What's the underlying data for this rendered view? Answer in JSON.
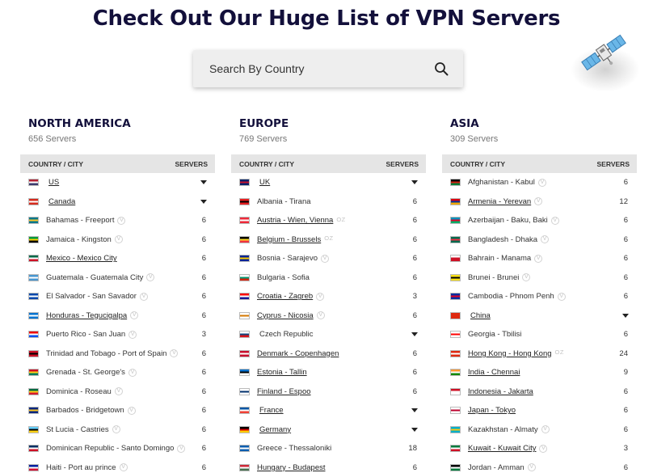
{
  "page": {
    "title": "Check Out Our Huge List of VPN Servers"
  },
  "search": {
    "placeholder": "Search By Country"
  },
  "regions": [
    {
      "title": "NORTH AMERICA",
      "count": "656 Servers",
      "col_country": "COUNTRY / CITY",
      "col_servers": "SERVERS",
      "rows": [
        {
          "name": "US",
          "servers": "",
          "expand": true,
          "link": true,
          "badge": "",
          "flag": [
            "#b22234",
            "#ffffff",
            "#3c3b6e"
          ]
        },
        {
          "name": "Canada",
          "servers": "",
          "expand": true,
          "link": true,
          "badge": "",
          "flag": [
            "#d52b1e",
            "#ffffff",
            "#d52b1e"
          ]
        },
        {
          "name": "Bahamas - Freeport",
          "servers": "6",
          "expand": false,
          "link": false,
          "badge": "V",
          "flag": [
            "#00778b",
            "#ffc72c",
            "#00778b"
          ]
        },
        {
          "name": "Jamaica - Kingston",
          "servers": "6",
          "expand": false,
          "link": false,
          "badge": "V",
          "flag": [
            "#009b3a",
            "#fed100",
            "#000000"
          ]
        },
        {
          "name": "Mexico - Mexico City",
          "servers": "6",
          "expand": false,
          "link": true,
          "badge": "",
          "flag": [
            "#006847",
            "#ffffff",
            "#ce1126"
          ]
        },
        {
          "name": "Guatemala - Guatemala City",
          "servers": "6",
          "expand": false,
          "link": false,
          "badge": "V",
          "flag": [
            "#4997d0",
            "#ffffff",
            "#4997d0"
          ]
        },
        {
          "name": "El Salvador - San Savador",
          "servers": "6",
          "expand": false,
          "link": false,
          "badge": "V",
          "flag": [
            "#0047ab",
            "#ffffff",
            "#0047ab"
          ]
        },
        {
          "name": "Honduras - Tegucigalpa",
          "servers": "6",
          "expand": false,
          "link": true,
          "badge": "V",
          "flag": [
            "#0073cf",
            "#ffffff",
            "#0073cf"
          ]
        },
        {
          "name": "Puerto Rico - San Juan",
          "servers": "3",
          "expand": false,
          "link": false,
          "badge": "V",
          "flag": [
            "#ed0000",
            "#ffffff",
            "#0050f0"
          ]
        },
        {
          "name": "Trinidad and Tobago - Port of Spain",
          "servers": "6",
          "expand": false,
          "link": false,
          "badge": "V",
          "flag": [
            "#ce1126",
            "#000000",
            "#ce1126"
          ]
        },
        {
          "name": "Grenada - St. George's",
          "servers": "6",
          "expand": false,
          "link": false,
          "badge": "V",
          "flag": [
            "#ce1126",
            "#fcd116",
            "#007a5e"
          ]
        },
        {
          "name": "Dominica - Roseau",
          "servers": "6",
          "expand": false,
          "link": false,
          "badge": "V",
          "flag": [
            "#006b3f",
            "#fcd116",
            "#d41c30"
          ]
        },
        {
          "name": "Barbados - Bridgetown",
          "servers": "6",
          "expand": false,
          "link": false,
          "badge": "V",
          "flag": [
            "#00267f",
            "#ffc726",
            "#00267f"
          ]
        },
        {
          "name": "St Lucia - Castries",
          "servers": "6",
          "expand": false,
          "link": false,
          "badge": "V",
          "flag": [
            "#65cfff",
            "#000000",
            "#fcd116"
          ]
        },
        {
          "name": "Dominican Republic - Santo Domingo",
          "servers": "6",
          "expand": false,
          "link": false,
          "badge": "V",
          "flag": [
            "#002d62",
            "#ffffff",
            "#ce1126"
          ]
        },
        {
          "name": "Haiti - Port au prince",
          "servers": "6",
          "expand": false,
          "link": false,
          "badge": "V",
          "flag": [
            "#00209f",
            "#ffffff",
            "#d21034"
          ]
        }
      ]
    },
    {
      "title": "EUROPE",
      "count": "769 Servers",
      "col_country": "COUNTRY / CITY",
      "col_servers": "SERVERS",
      "rows": [
        {
          "name": "UK",
          "servers": "",
          "expand": true,
          "link": true,
          "badge": "",
          "flag": [
            "#012169",
            "#c8102e",
            "#012169"
          ]
        },
        {
          "name": "Albania - Tirana",
          "servers": "6",
          "expand": false,
          "link": false,
          "badge": "",
          "flag": [
            "#e41e20",
            "#000000",
            "#e41e20"
          ]
        },
        {
          "name": "Austria - Wien, Vienna",
          "servers": "6",
          "expand": false,
          "link": true,
          "badge": "OZ",
          "flag": [
            "#ed2939",
            "#ffffff",
            "#ed2939"
          ]
        },
        {
          "name": "Belgium - Brussels",
          "servers": "6",
          "expand": false,
          "link": true,
          "badge": "OZ",
          "flag": [
            "#000000",
            "#fdda24",
            "#ef3340"
          ]
        },
        {
          "name": "Bosnia - Sarajevo",
          "servers": "6",
          "expand": false,
          "link": false,
          "badge": "V",
          "flag": [
            "#002395",
            "#fecb00",
            "#002395"
          ]
        },
        {
          "name": "Bulgaria - Sofia",
          "servers": "6",
          "expand": false,
          "link": false,
          "badge": "",
          "flag": [
            "#ffffff",
            "#00966e",
            "#d62612"
          ]
        },
        {
          "name": "Croatia - Zagreb",
          "servers": "3",
          "expand": false,
          "link": true,
          "badge": "V",
          "flag": [
            "#ff0000",
            "#ffffff",
            "#171796"
          ]
        },
        {
          "name": "Cyprus - Nicosia",
          "servers": "6",
          "expand": false,
          "link": true,
          "badge": "V",
          "flag": [
            "#ffffff",
            "#d57800",
            "#ffffff"
          ]
        },
        {
          "name": "Czech Republic",
          "servers": "",
          "expand": true,
          "link": false,
          "badge": "",
          "flag": [
            "#ffffff",
            "#11457e",
            "#d7141a"
          ]
        },
        {
          "name": "Denmark - Copenhagen",
          "servers": "6",
          "expand": false,
          "link": true,
          "badge": "",
          "flag": [
            "#c8102e",
            "#ffffff",
            "#c8102e"
          ]
        },
        {
          "name": "Estonia - Tallin",
          "servers": "6",
          "expand": false,
          "link": true,
          "badge": "",
          "flag": [
            "#0072ce",
            "#000000",
            "#ffffff"
          ]
        },
        {
          "name": "Finland - Espoo",
          "servers": "6",
          "expand": false,
          "link": true,
          "badge": "",
          "flag": [
            "#ffffff",
            "#002f6c",
            "#ffffff"
          ]
        },
        {
          "name": "France",
          "servers": "",
          "expand": true,
          "link": true,
          "badge": "",
          "flag": [
            "#0055a4",
            "#ffffff",
            "#ef4135"
          ]
        },
        {
          "name": "Germany",
          "servers": "",
          "expand": true,
          "link": true,
          "badge": "",
          "flag": [
            "#000000",
            "#dd0000",
            "#ffce00"
          ]
        },
        {
          "name": "Greece - Thessaloniki",
          "servers": "18",
          "expand": false,
          "link": false,
          "badge": "",
          "flag": [
            "#0d5eaf",
            "#ffffff",
            "#0d5eaf"
          ]
        },
        {
          "name": "Hungary - Budapest",
          "servers": "6",
          "expand": false,
          "link": true,
          "badge": "",
          "flag": [
            "#ce2939",
            "#ffffff",
            "#477050"
          ]
        }
      ]
    },
    {
      "title": "ASIA",
      "count": "309 Servers",
      "col_country": "COUNTRY / CITY",
      "col_servers": "SERVERS",
      "rows": [
        {
          "name": "Afghanistan - Kabul",
          "servers": "6",
          "expand": false,
          "link": false,
          "badge": "V",
          "flag": [
            "#000000",
            "#d32011",
            "#007a36"
          ]
        },
        {
          "name": "Armenia - Yerevan",
          "servers": "12",
          "expand": false,
          "link": true,
          "badge": "V",
          "flag": [
            "#d90012",
            "#0033a0",
            "#f2a800"
          ]
        },
        {
          "name": "Azerbaijan - Baku, Baki",
          "servers": "6",
          "expand": false,
          "link": false,
          "badge": "V",
          "flag": [
            "#0092bc",
            "#e4002b",
            "#00af66"
          ]
        },
        {
          "name": "Bangladesh - Dhaka",
          "servers": "6",
          "expand": false,
          "link": false,
          "badge": "V",
          "flag": [
            "#006a4e",
            "#f42a41",
            "#006a4e"
          ]
        },
        {
          "name": "Bahrain - Manama",
          "servers": "6",
          "expand": false,
          "link": false,
          "badge": "V",
          "flag": [
            "#ffffff",
            "#ce1126",
            "#ce1126"
          ]
        },
        {
          "name": "Brunei - Brunei",
          "servers": "6",
          "expand": false,
          "link": false,
          "badge": "V",
          "flag": [
            "#f7e017",
            "#000000",
            "#f7e017"
          ]
        },
        {
          "name": "Cambodia - Phnom Penh",
          "servers": "6",
          "expand": false,
          "link": false,
          "badge": "V",
          "flag": [
            "#032ea1",
            "#e00025",
            "#032ea1"
          ]
        },
        {
          "name": "China",
          "servers": "",
          "expand": true,
          "link": true,
          "badge": "",
          "flag": [
            "#de2910",
            "#de2910",
            "#de2910"
          ]
        },
        {
          "name": "Georgia - Tbilisi",
          "servers": "6",
          "expand": false,
          "link": false,
          "badge": "",
          "flag": [
            "#ffffff",
            "#ff0000",
            "#ffffff"
          ]
        },
        {
          "name": "Hong Kong - Hong Kong",
          "servers": "24",
          "expand": false,
          "link": true,
          "badge": "OZ",
          "flag": [
            "#de2910",
            "#ffffff",
            "#de2910"
          ]
        },
        {
          "name": "India - Chennai",
          "servers": "9",
          "expand": false,
          "link": true,
          "badge": "",
          "flag": [
            "#ff9933",
            "#ffffff",
            "#138808"
          ]
        },
        {
          "name": "Indonesia - Jakarta",
          "servers": "6",
          "expand": false,
          "link": true,
          "badge": "",
          "flag": [
            "#ce1126",
            "#ffffff",
            "#ffffff"
          ]
        },
        {
          "name": "Japan - Tokyo",
          "servers": "6",
          "expand": false,
          "link": true,
          "badge": "",
          "flag": [
            "#ffffff",
            "#bc002d",
            "#ffffff"
          ]
        },
        {
          "name": "Kazakhstan - Almaty",
          "servers": "6",
          "expand": false,
          "link": false,
          "badge": "V",
          "flag": [
            "#00afca",
            "#fec50c",
            "#00afca"
          ]
        },
        {
          "name": "Kuwait - Kuwait City",
          "servers": "3",
          "expand": false,
          "link": true,
          "badge": "V",
          "flag": [
            "#007a3d",
            "#ffffff",
            "#ce1126"
          ]
        },
        {
          "name": "Jordan - Amman",
          "servers": "6",
          "expand": false,
          "link": false,
          "badge": "V",
          "flag": [
            "#000000",
            "#ffffff",
            "#007a3d"
          ]
        }
      ]
    }
  ],
  "icons": {
    "search": "search-icon",
    "satellite": "satellite-icon",
    "expand": "caret-down-icon"
  },
  "colors": {
    "title": "#13103b",
    "header_bg": "#e5e5e5",
    "search_bg": "#eeeeee"
  }
}
